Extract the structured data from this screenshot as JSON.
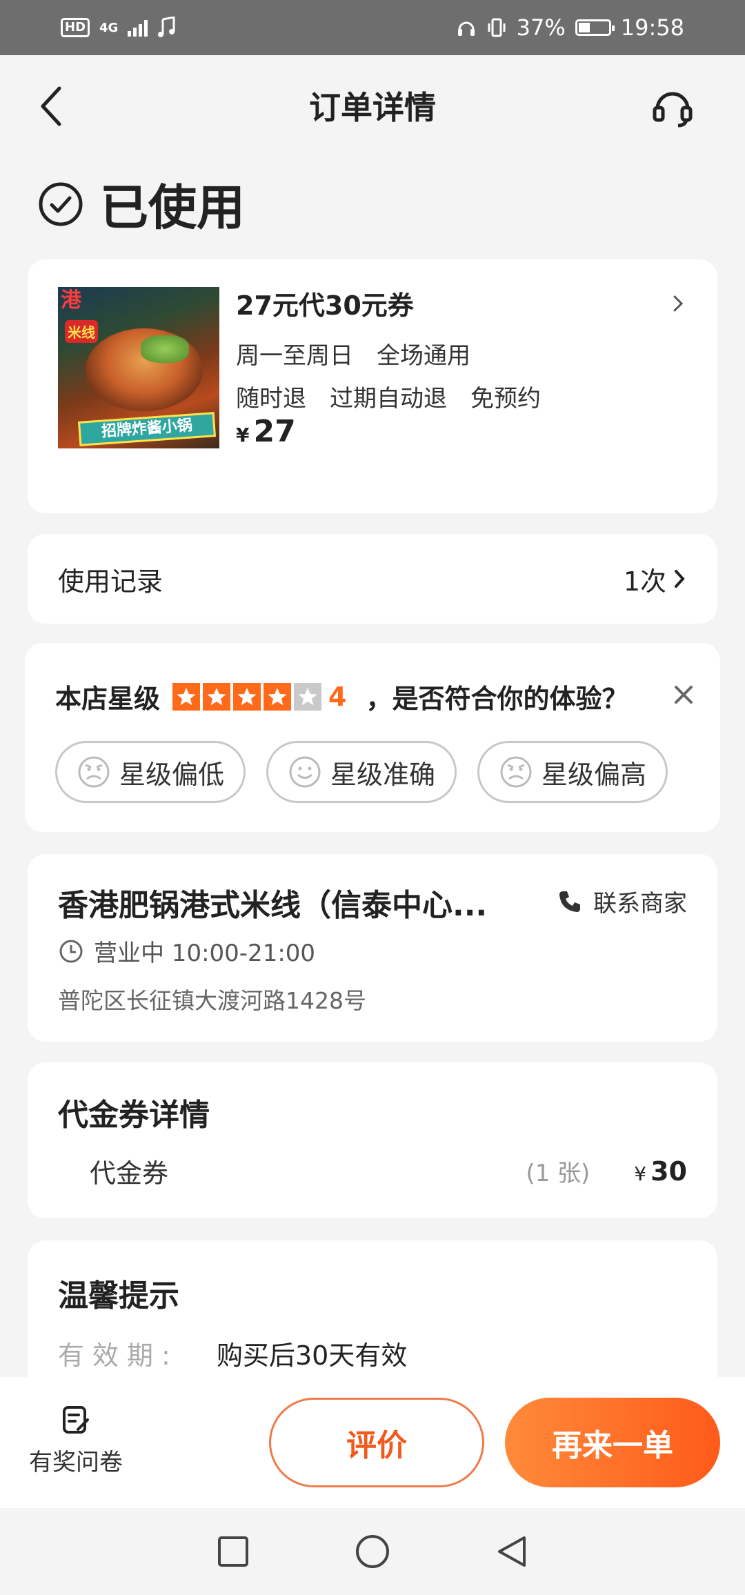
{
  "status_bar": {
    "hd_badge": "HD",
    "network": "4G",
    "battery": "37%",
    "battery_fraction": 0.37,
    "time": "19:58"
  },
  "header": {
    "title": "订单详情"
  },
  "order_status": {
    "text": "已使用"
  },
  "product": {
    "title": "27元代30元券",
    "tags_line1": [
      "周一至周日",
      "全场通用"
    ],
    "tags_line2": [
      "随时退",
      "过期自动退",
      "免预约"
    ],
    "currency": "¥",
    "price": "27",
    "image_sign1": "港",
    "image_sign2": "米线",
    "image_banner": "招牌炸酱小锅"
  },
  "usage_record": {
    "label": "使用记录",
    "count": "1次"
  },
  "rating": {
    "label": "本店星级",
    "stars": 4,
    "max_stars": 5,
    "score": "4",
    "question": "，是否符合你的体验？",
    "options": [
      {
        "label": "星级偏低",
        "icon": "sad-face-icon"
      },
      {
        "label": "星级准确",
        "icon": "smile-face-icon"
      },
      {
        "label": "星级偏高",
        "icon": "sad-face-icon"
      }
    ],
    "accent_color": "#ff6a1a"
  },
  "store": {
    "name": "香港肥锅港式米线（信泰中心...",
    "contact_label": "联系商家",
    "hours": "营业中 10:00-21:00",
    "address": "普陀区长征镇大渡河路1428号"
  },
  "voucher_details": {
    "title": "代金券详情",
    "item_name": "代金券",
    "quantity": "(1 张)",
    "currency": "¥",
    "price": "30"
  },
  "tips": {
    "title": "温馨提示",
    "validity_key": "有效期:",
    "validity_value": "购买后30天有效"
  },
  "bottom_bar": {
    "survey_label": "有奖问卷",
    "review_label": "评价",
    "reorder_label": "再来一单",
    "brand_color": "#ff5a1a"
  }
}
